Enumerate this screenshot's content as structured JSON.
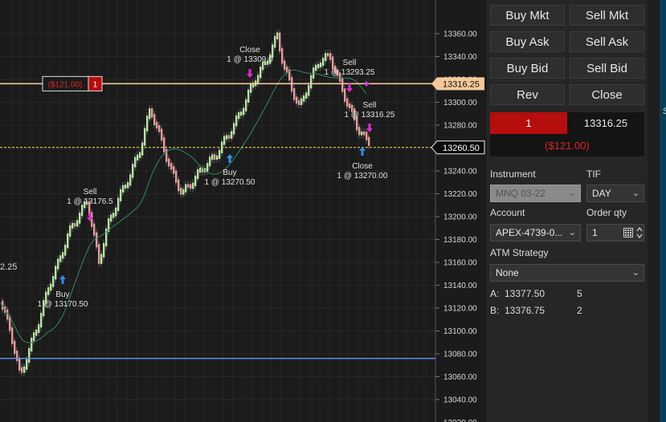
{
  "chart": {
    "price_levels": [
      "13360.00",
      "13340.00",
      "13320.00",
      "13300.00",
      "13280.00",
      "13260.00",
      "13240.00",
      "13220.00",
      "13200.00",
      "13180.00",
      "13160.00",
      "13140.00",
      "13120.00",
      "13100.00",
      "13080.00",
      "13060.00",
      "13040.00",
      "13020.00"
    ],
    "left_edge_fragment": "2.25",
    "position_line": {
      "price": 13316.25,
      "price_label": "13316.25",
      "pnl_label": "($121.00)",
      "qty_label": "1"
    },
    "last_price": {
      "price": 13260.5,
      "label": "13260.50"
    },
    "blue_line_price": 13076,
    "annotations": [
      {
        "name": "buy-1",
        "lines": [
          "Buy",
          "1 @ 13170.50"
        ]
      },
      {
        "name": "sell-1",
        "lines": [
          "Sell",
          "1 @ 13176.5"
        ]
      },
      {
        "name": "buy-2",
        "lines": [
          "Buy",
          "1 @ 13270.50"
        ]
      },
      {
        "name": "close-1",
        "lines": [
          "Close",
          "1 @ 13309.0"
        ]
      },
      {
        "name": "sell-2",
        "lines": [
          "Sell",
          "1 @ 13293.25"
        ]
      },
      {
        "name": "sell-3",
        "lines": [
          "Sell",
          "1 @ 13316.25"
        ]
      },
      {
        "name": "close-2",
        "lines": [
          "Close",
          "1 @ 13270.00"
        ]
      }
    ],
    "colors": {
      "up_bar": "#b6e3a3",
      "down_bar": "#e79a9a",
      "ma_line": "#2f8a5a",
      "position_line": "#f5c89a",
      "last_line": "#e8e04a",
      "blue_line": "#5b8ee6",
      "buy_arrow": "#2f8fe6",
      "sell_arrow": "#e02bd6"
    }
  },
  "buttons": {
    "buy_mkt": "Buy Mkt",
    "sell_mkt": "Sell Mkt",
    "buy_ask": "Buy Ask",
    "sell_ask": "Sell Ask",
    "buy_bid": "Buy Bid",
    "sell_bid": "Sell Bid",
    "rev": "Rev",
    "close": "Close"
  },
  "position": {
    "qty": "1",
    "avg_price": "13316.25",
    "pnl": "($121.00)"
  },
  "order": {
    "instrument_label": "Instrument",
    "instrument_value": "MNQ 03-22",
    "tif_label": "TIF",
    "tif_value": "DAY",
    "account_label": "Account",
    "account_value": "APEX-4739-0...",
    "order_qty_label": "Order qty",
    "order_qty_value": "1",
    "atm_label": "ATM Strategy",
    "atm_value": "None"
  },
  "market": {
    "ask_label": "A:",
    "ask_price": "13377.50",
    "ask_size": "5",
    "bid_label": "B:",
    "bid_price": "13376.75",
    "bid_size": "2"
  },
  "right_fragment": "Sa"
}
